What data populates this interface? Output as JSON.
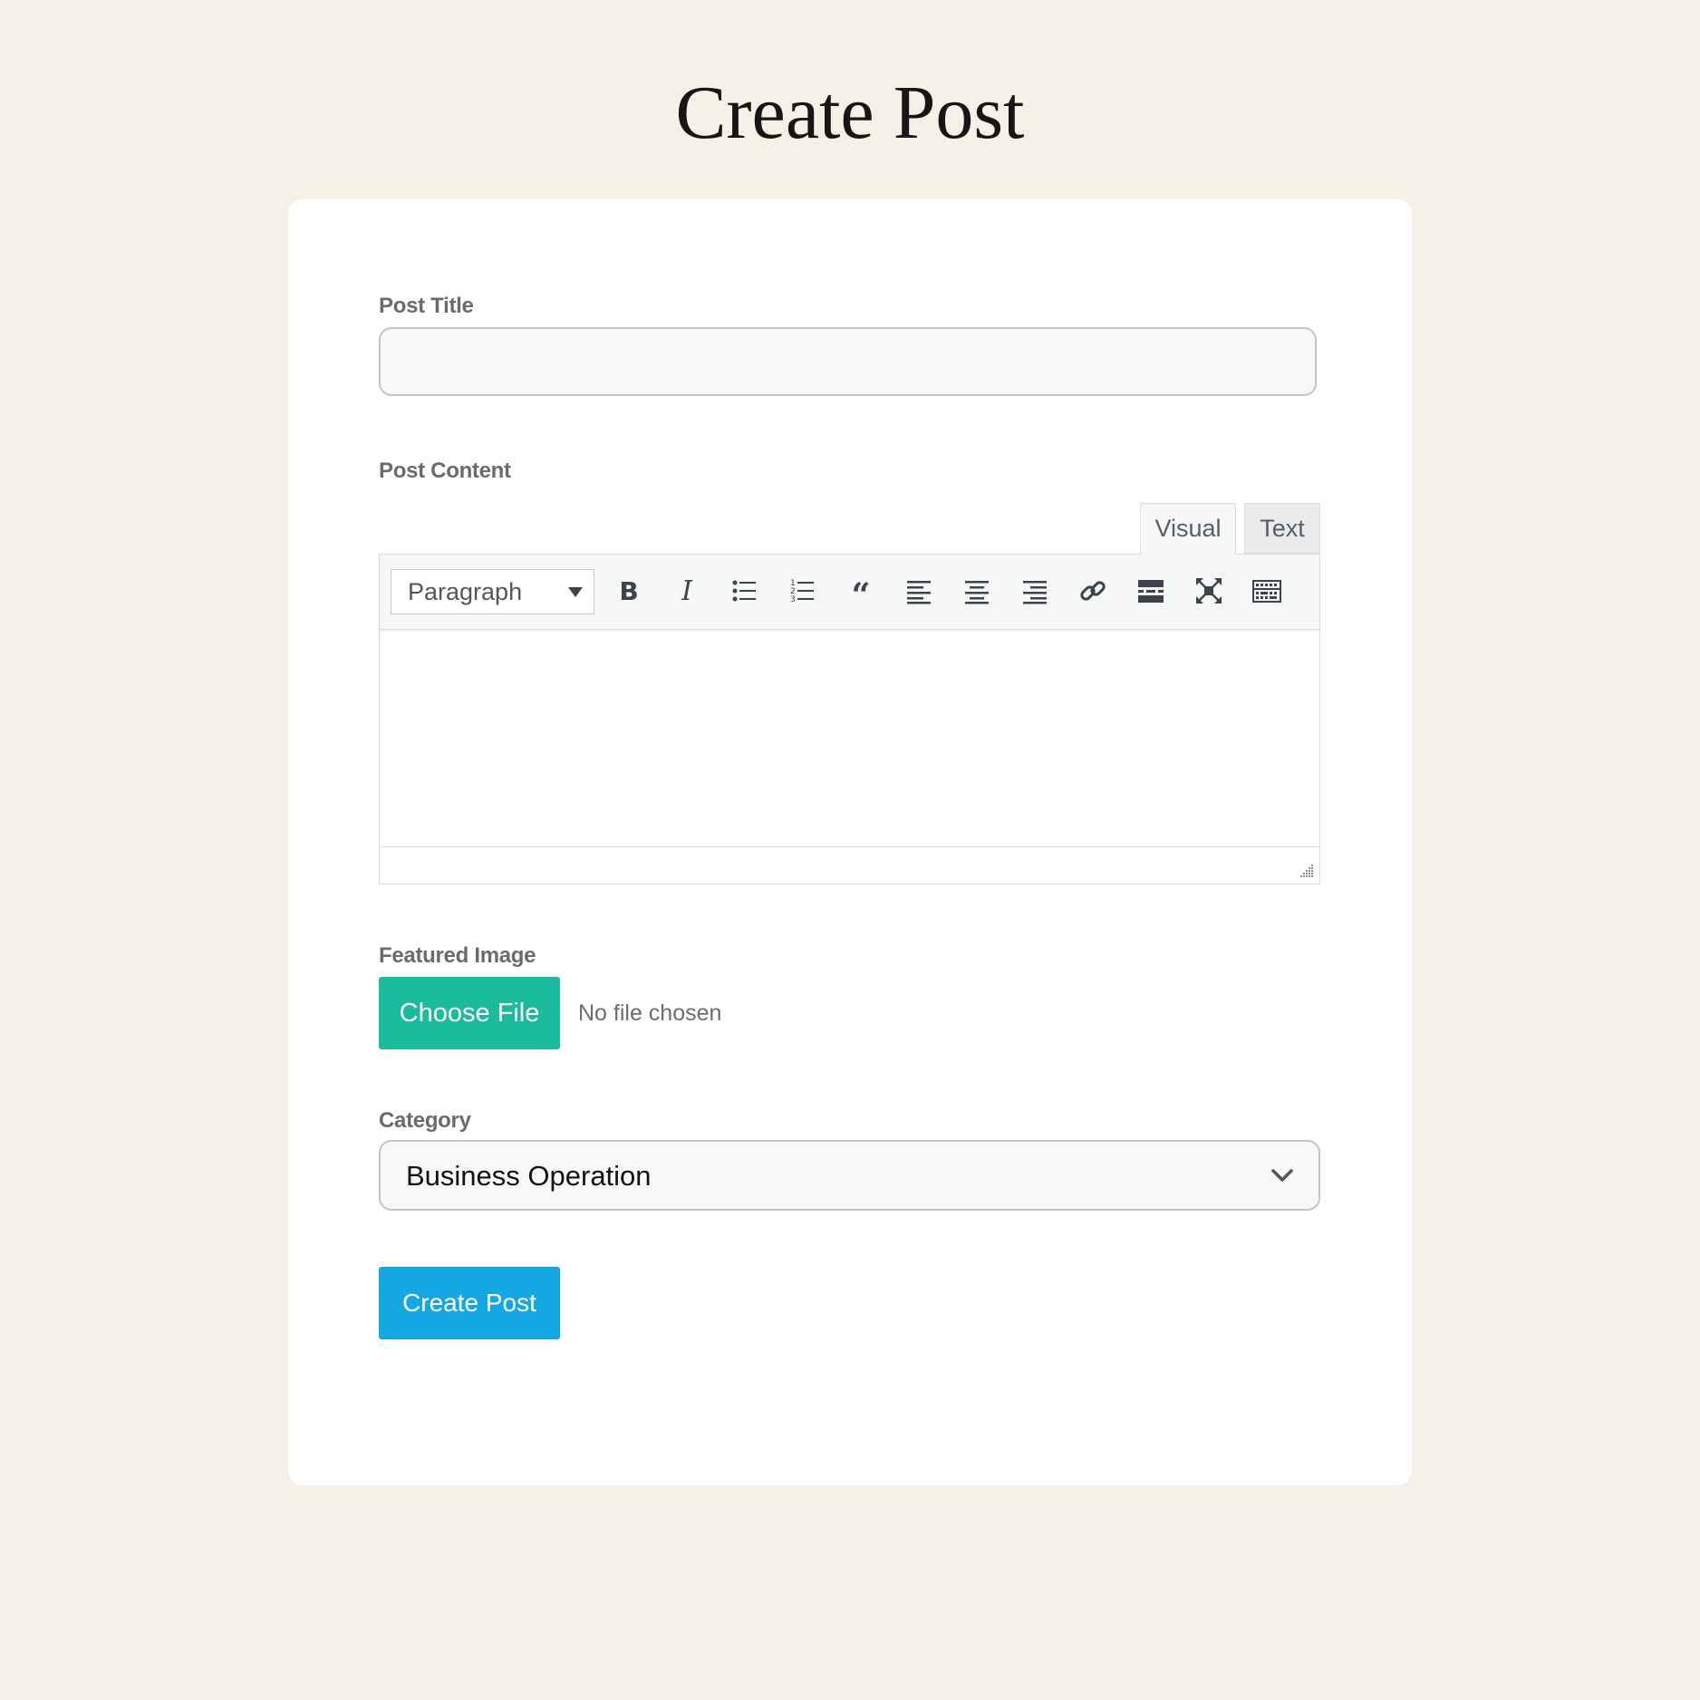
{
  "page": {
    "title": "Create Post"
  },
  "form": {
    "post_title": {
      "label": "Post Title",
      "value": "",
      "placeholder": ""
    },
    "post_content": {
      "label": "Post Content",
      "tabs": [
        {
          "label": "Visual",
          "active": true
        },
        {
          "label": "Text",
          "active": false
        }
      ],
      "format_select": {
        "value": "Paragraph"
      },
      "toolbar_icons": [
        "bold-icon",
        "italic-icon",
        "bulleted-list-icon",
        "numbered-list-icon",
        "blockquote-icon",
        "align-left-icon",
        "align-center-icon",
        "align-right-icon",
        "link-icon",
        "read-more-icon",
        "fullscreen-icon",
        "toolbar-toggle-icon"
      ],
      "content": ""
    },
    "featured_image": {
      "label": "Featured Image",
      "button_label": "Choose File",
      "status": "No file chosen"
    },
    "category": {
      "label": "Category",
      "value": "Business Operation"
    },
    "submit_label": "Create Post"
  },
  "colors": {
    "background": "#f5f1e6",
    "card": "#ffffff",
    "choose_file_button": "#1bbc9b",
    "submit_button": "#14a7e3"
  }
}
